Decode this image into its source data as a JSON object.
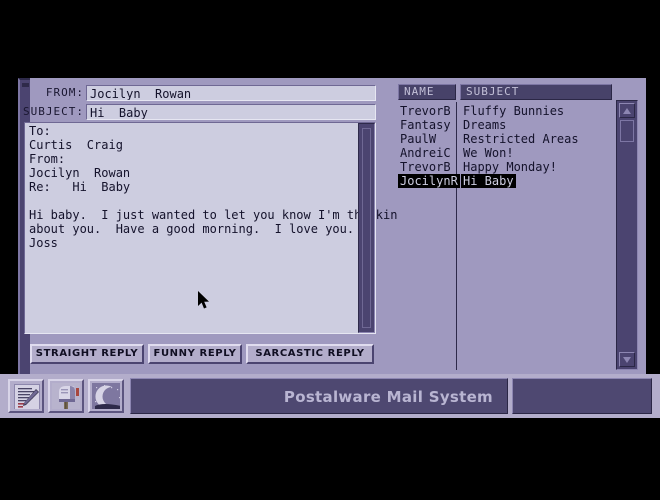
{
  "app": {
    "title": "Postalware Mail System"
  },
  "message": {
    "from_label": "FROM:",
    "from_value": "Jocilyn  Rowan",
    "subject_label": "SUBJECT:",
    "subject_value": "Hi  Baby",
    "body": "To:\nCurtis  Craig\nFrom:\nJocilyn  Rowan\nRe:   Hi  Baby\n\nHi baby.  I just wanted to let you know I'm thinking\nabout you.  Have a good morning.  I love you.\nJoss"
  },
  "reply_buttons": [
    {
      "id": "straight",
      "label": "STRAIGHT REPLY"
    },
    {
      "id": "funny",
      "label": "FUNNY REPLY"
    },
    {
      "id": "sarcastic",
      "label": "SARCASTIC REPLY"
    }
  ],
  "list": {
    "headers": {
      "name": "NAME",
      "subject": "SUBJECT"
    },
    "rows": [
      {
        "name": "TrevorB",
        "subject": "Fluffy Bunnies",
        "selected": false
      },
      {
        "name": "Fantasy",
        "subject": "Dreams",
        "selected": false
      },
      {
        "name": "PaulW",
        "subject": "Restricted Areas",
        "selected": false
      },
      {
        "name": "AndreiC",
        "subject": "We Won!",
        "selected": false
      },
      {
        "name": "TrevorB",
        "subject": "Happy Monday!",
        "selected": false
      },
      {
        "name": "JocilynR",
        "subject": "Hi Baby",
        "selected": true
      }
    ]
  },
  "taskbar": {
    "icons": [
      {
        "id": "compose",
        "name": "compose-note-icon"
      },
      {
        "id": "mailbox",
        "name": "mailbox-icon"
      },
      {
        "id": "sleep",
        "name": "moon-sleep-icon"
      }
    ]
  },
  "scrollbar": {
    "up_icon": "scroll-up-arrow-icon",
    "down_icon": "scroll-down-arrow-icon"
  },
  "colors": {
    "desktop": "#000000",
    "window_face": "#9f99bf",
    "panel_bg": "#cdcde0",
    "dark_navy": "#4b4470",
    "header_navy": "#474269",
    "button_face": "#b3adcb",
    "text_dark": "#14122b",
    "title_text": "#b9b5d2"
  }
}
